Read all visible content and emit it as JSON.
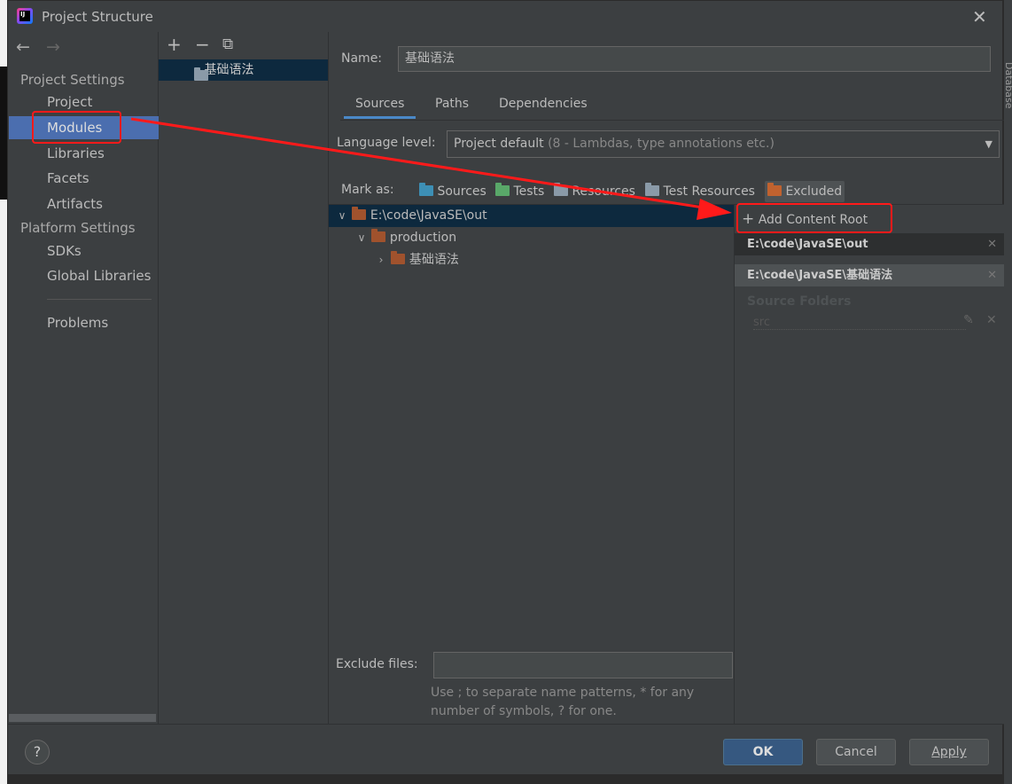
{
  "window": {
    "title": "Project Structure",
    "logo_text": "IJ",
    "side_tab": "Database"
  },
  "sidebar": {
    "back": "←",
    "forward": "→",
    "project_settings": "Project Settings",
    "items": [
      {
        "label": "Project"
      },
      {
        "label": "Modules"
      },
      {
        "label": "Libraries"
      },
      {
        "label": "Facets"
      },
      {
        "label": "Artifacts"
      }
    ],
    "platform_settings": "Platform Settings",
    "platform_items": [
      {
        "label": "SDKs"
      },
      {
        "label": "Global Libraries"
      }
    ],
    "problems": "Problems"
  },
  "modules": {
    "add": "+",
    "remove": "−",
    "copy": "⧉",
    "items": [
      {
        "label": "基础语法"
      }
    ]
  },
  "main": {
    "name_label": "Name:",
    "name_value": "基础语法",
    "tabs": [
      {
        "label": "Sources"
      },
      {
        "label": "Paths"
      },
      {
        "label": "Dependencies"
      }
    ],
    "language_label": "Language level:",
    "language_value": "Project default",
    "language_hint": "(8 - Lambdas, type annotations etc.)",
    "mark_as": "Mark as:",
    "marks": [
      {
        "label": "Sources",
        "color": "#3d8fb5"
      },
      {
        "label": "Tests",
        "color": "#59a869"
      },
      {
        "label": "Resources",
        "color": "#8a9aa8"
      },
      {
        "label": "Test Resources",
        "color": "#8a9aa8"
      },
      {
        "label": "Excluded",
        "color": "#c0622f"
      }
    ],
    "tree": [
      {
        "label": "E:\\code\\JavaSE\\out"
      },
      {
        "label": "production"
      },
      {
        "label": "基础语法"
      }
    ],
    "add_content_root": "Add Content Root",
    "content_roots": [
      {
        "label": "E:\\code\\JavaSE\\out"
      },
      {
        "label": "E:\\code\\JavaSE\\基础语法"
      }
    ],
    "source_folders": "Source Folders",
    "source_folder": "src",
    "exclude_label": "Exclude files:",
    "exclude_value": "",
    "exclude_hint1": "Use ; to separate name patterns, * for any",
    "exclude_hint2": "number of symbols, ? for one."
  },
  "footer": {
    "help": "?",
    "ok": "OK",
    "cancel": "Cancel",
    "apply": "Apply"
  },
  "annotation_color": "#ff1a1a"
}
